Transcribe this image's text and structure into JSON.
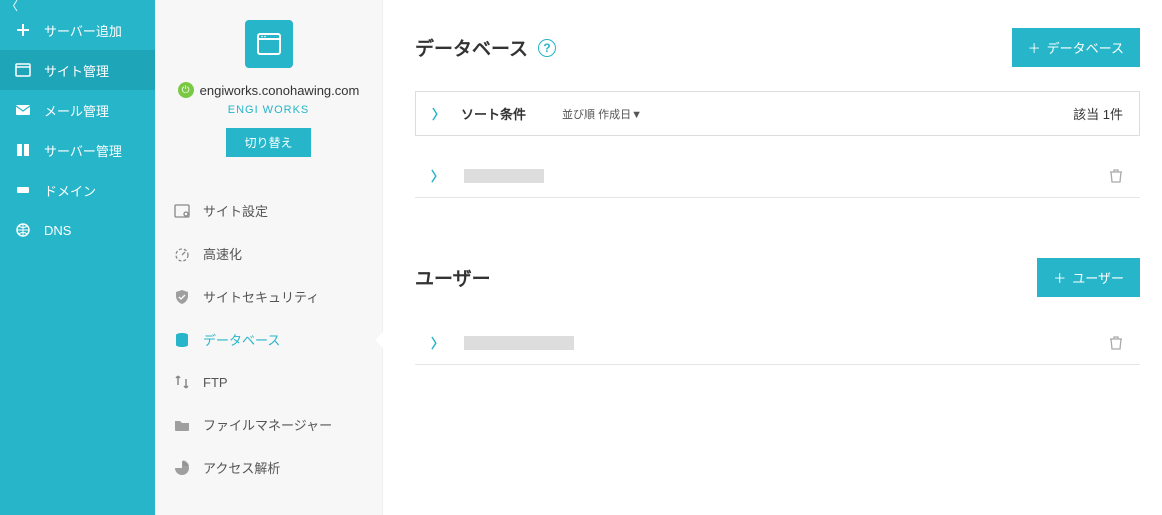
{
  "nav": {
    "items": [
      {
        "label": "サーバー追加"
      },
      {
        "label": "サイト管理"
      },
      {
        "label": "メール管理"
      },
      {
        "label": "サーバー管理"
      },
      {
        "label": "ドメイン"
      },
      {
        "label": "DNS"
      }
    ]
  },
  "site": {
    "domain": "engiworks.conohawing.com",
    "sublabel": "ENGI WORKS",
    "switch_label": "切り替え"
  },
  "menu2": {
    "items": [
      {
        "label": "サイト設定"
      },
      {
        "label": "高速化"
      },
      {
        "label": "サイトセキュリティ"
      },
      {
        "label": "データベース"
      },
      {
        "label": "FTP"
      },
      {
        "label": "ファイルマネージャー"
      },
      {
        "label": "アクセス解析"
      }
    ]
  },
  "db": {
    "title": "データベース",
    "add_label": "データベース",
    "sort_label": "ソート条件",
    "sort_sub": "並び順  作成日▼",
    "count": "該当 1件"
  },
  "user": {
    "title": "ユーザー",
    "add_label": "ユーザー"
  }
}
